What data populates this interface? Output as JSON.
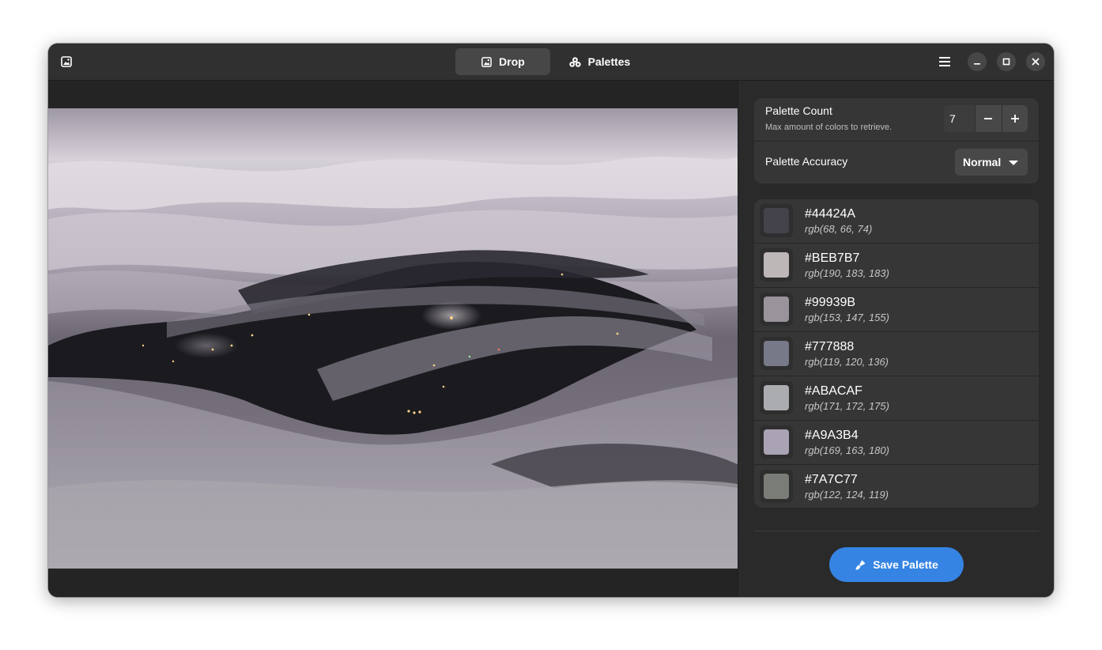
{
  "header": {
    "app_icon": "image-icon",
    "tabs": [
      {
        "label": "Drop",
        "icon": "image-icon",
        "active": true
      },
      {
        "label": "Palettes",
        "icon": "palette-icon",
        "active": false
      }
    ],
    "menu_icon": "hamburger-menu-icon",
    "window_buttons": [
      "minimize-icon",
      "maximize-icon",
      "close-icon"
    ]
  },
  "settings": {
    "count": {
      "title": "Palette Count",
      "subtitle": "Max amount of colors to retrieve.",
      "value": "7"
    },
    "accuracy": {
      "title": "Palette Accuracy",
      "value": "Normal"
    }
  },
  "palette": [
    {
      "hex": "#44424A",
      "rgb": "rgb(68, 66, 74)",
      "color": "#44424A"
    },
    {
      "hex": "#BEB7B7",
      "rgb": "rgb(190, 183, 183)",
      "color": "#BEB7B7"
    },
    {
      "hex": "#99939B",
      "rgb": "rgb(153, 147, 155)",
      "color": "#99939B"
    },
    {
      "hex": "#777888",
      "rgb": "rgb(119, 120, 136)",
      "color": "#777888"
    },
    {
      "hex": "#ABACAF",
      "rgb": "rgb(171, 172, 175)",
      "color": "#ABACAF"
    },
    {
      "hex": "#A9A3B4",
      "rgb": "rgb(169, 163, 180)",
      "color": "#A9A3B4"
    },
    {
      "hex": "#7A7C77",
      "rgb": "rgb(122, 124, 119)",
      "color": "#7A7C77"
    }
  ],
  "save_button": {
    "label": "Save Palette",
    "icon": "brush-icon"
  },
  "colors": {
    "accent": "#3584e4",
    "window_bg": "#242424",
    "header_bg": "#303030",
    "card_bg": "#363636"
  }
}
